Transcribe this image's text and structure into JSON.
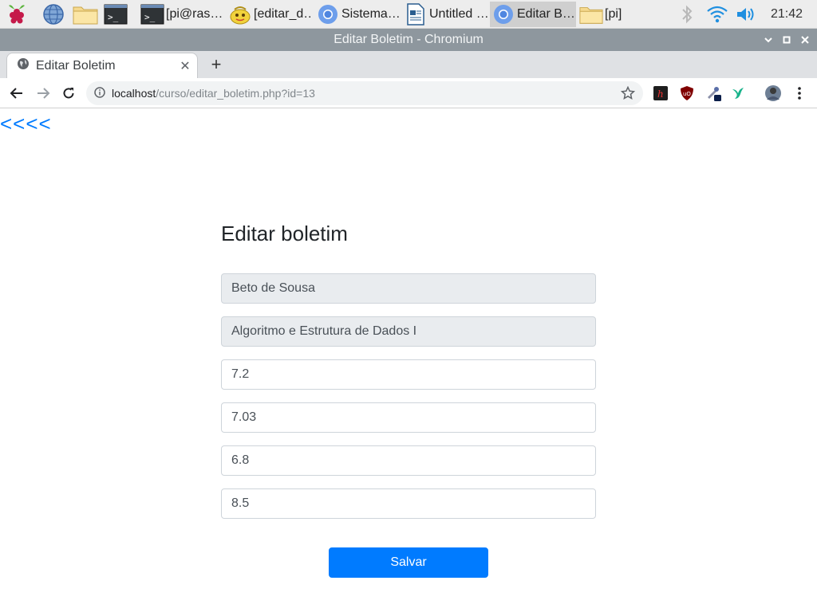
{
  "taskbar": {
    "tasks": [
      {
        "label": "[pi@ras…",
        "icon": "terminal-icon"
      },
      {
        "label": "[editar_d…",
        "icon": "text-editor-icon"
      },
      {
        "label": "Sistema…",
        "icon": "chromium-icon"
      },
      {
        "label": "Untitled …",
        "icon": "writer-document-icon"
      },
      {
        "label": "Editar B…",
        "icon": "chromium-icon"
      },
      {
        "label": "[pi]",
        "icon": "folder-icon"
      }
    ],
    "clock": "21:42"
  },
  "window": {
    "title": "Editar Boletim - Chromium"
  },
  "browser": {
    "tab_title": "Editar Boletim",
    "url_host": "localhost",
    "url_path": "/curso/editar_boletim.php?id=13"
  },
  "page": {
    "back_link": "<<<<",
    "title": "Editar boletim",
    "fields": {
      "aluno": "Beto de Sousa",
      "disciplina": "Algoritmo e Estrutura de Dados I",
      "nota1": "7.2",
      "nota2": "7.03",
      "nota3": "6.8",
      "nota4": "8.5"
    },
    "save_label": "Salvar"
  },
  "colors": {
    "accent": "#007bff",
    "titlebar": "#8e979e",
    "readonly_field": "#e9ecef"
  }
}
